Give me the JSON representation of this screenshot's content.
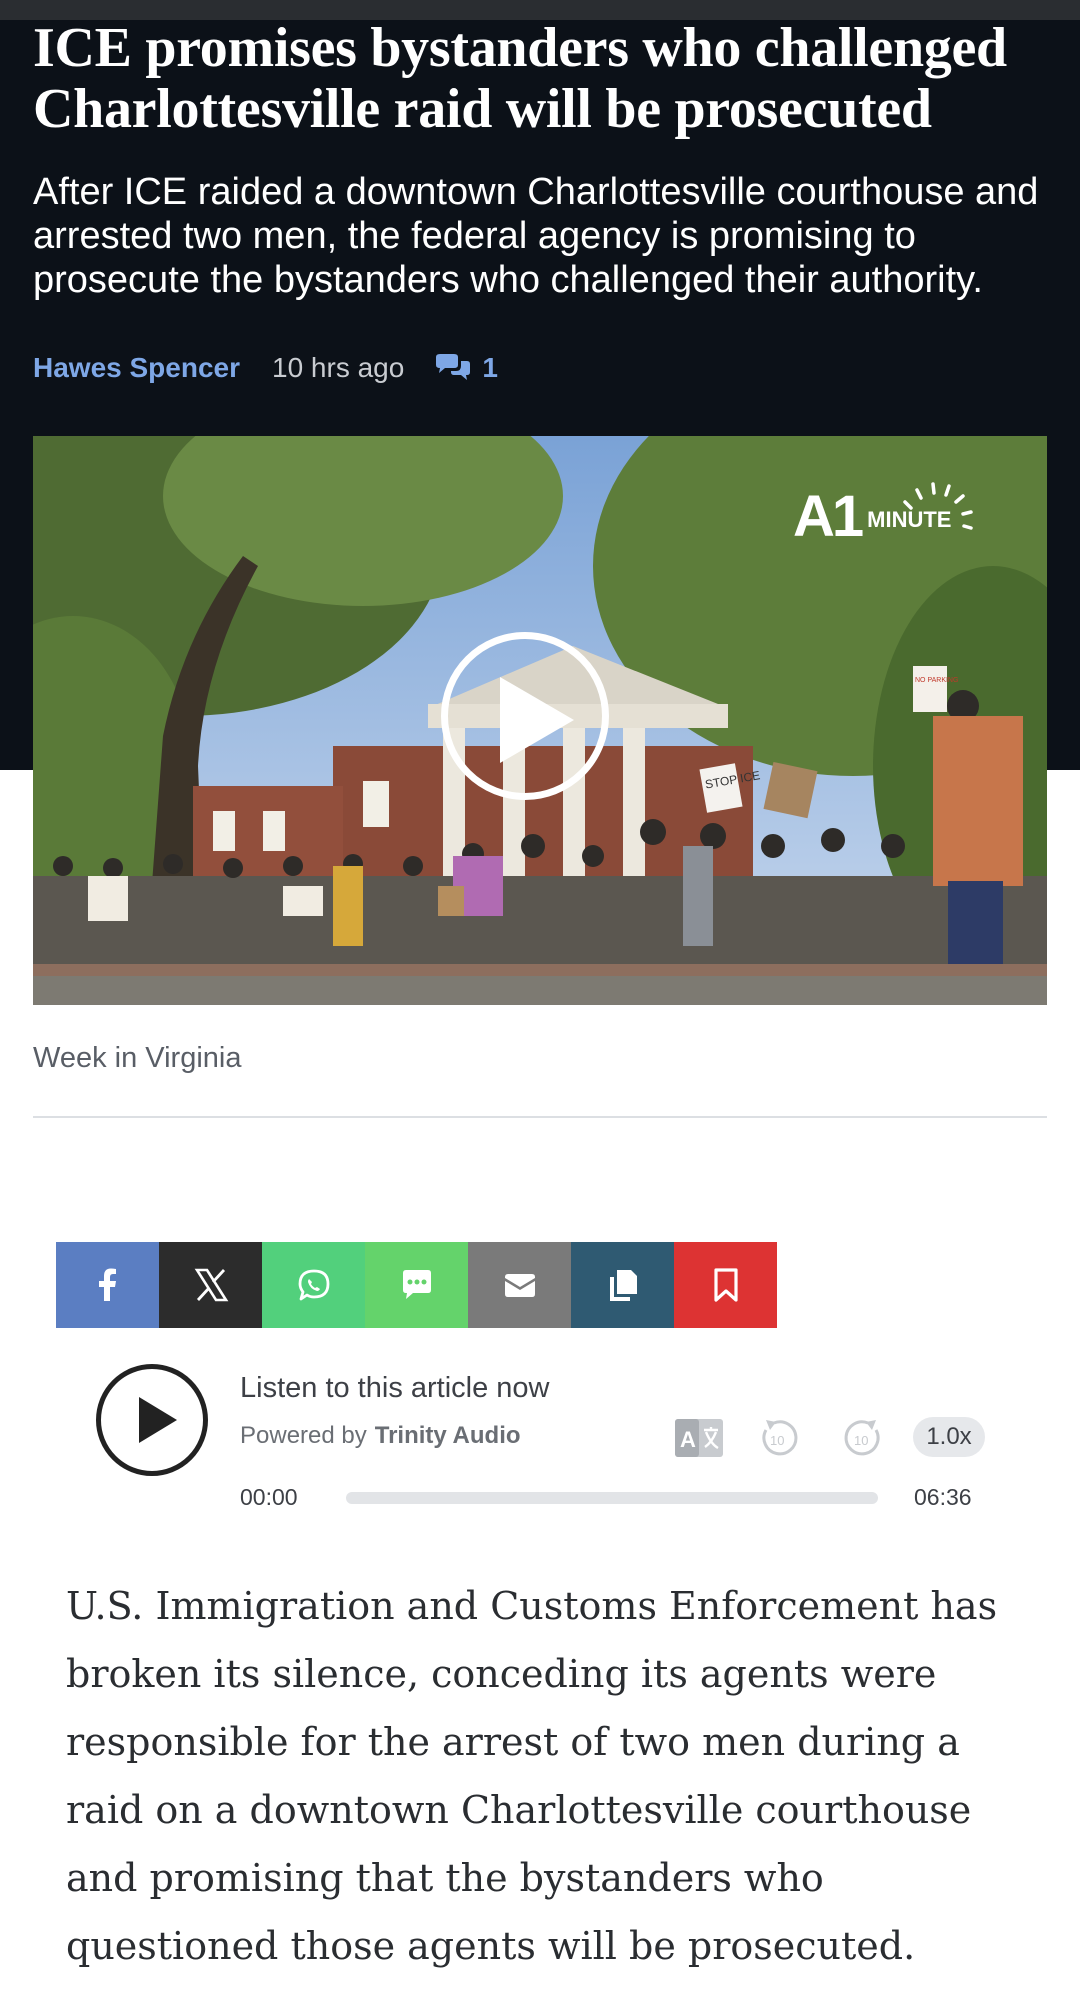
{
  "article": {
    "headline": "ICE promises bystanders who challenged Charlottesville raid will be prosecuted",
    "subheadline": "After ICE raided a downtown Charlottesville courthouse and arrested two men, the federal agency is promising to prosecute the bystanders who challenged their authority.",
    "author": "Hawes Spencer",
    "time_ago": "10 hrs ago",
    "comment_count": "1",
    "body": "U.S. Immigration and Customs Enforcement has broken its silence, conceding its agents were responsible for the arrest of two men during a raid on a downtown Charlottesville courthouse and promising that the bystanders who questioned those agents will be prosecuted."
  },
  "video": {
    "logo_a1": "A1",
    "logo_minute": "MINUTE",
    "caption": "Week in Virginia",
    "sign_stop_ice": "STOP ICE",
    "sign_no_parking": "NO PARKING"
  },
  "share": {
    "buttons": [
      {
        "name": "facebook",
        "color": "#5b7ec2"
      },
      {
        "name": "x",
        "color": "#2c2c2c"
      },
      {
        "name": "whatsapp",
        "color": "#52d07c"
      },
      {
        "name": "sms",
        "color": "#64d36b"
      },
      {
        "name": "email",
        "color": "#7a7a7a"
      },
      {
        "name": "copy",
        "color": "#2f5a72"
      },
      {
        "name": "bookmark",
        "color": "#dd3333"
      }
    ]
  },
  "audio": {
    "listen_label": "Listen to this article now",
    "powered_by": "Powered by",
    "provider": "Trinity Audio",
    "speed": "1.0x",
    "time_current": "00:00",
    "time_total": "06:36",
    "progress_fraction": 0
  },
  "colors": {
    "header_bg": "#0c1118",
    "accent_link": "#7ea7e6"
  }
}
